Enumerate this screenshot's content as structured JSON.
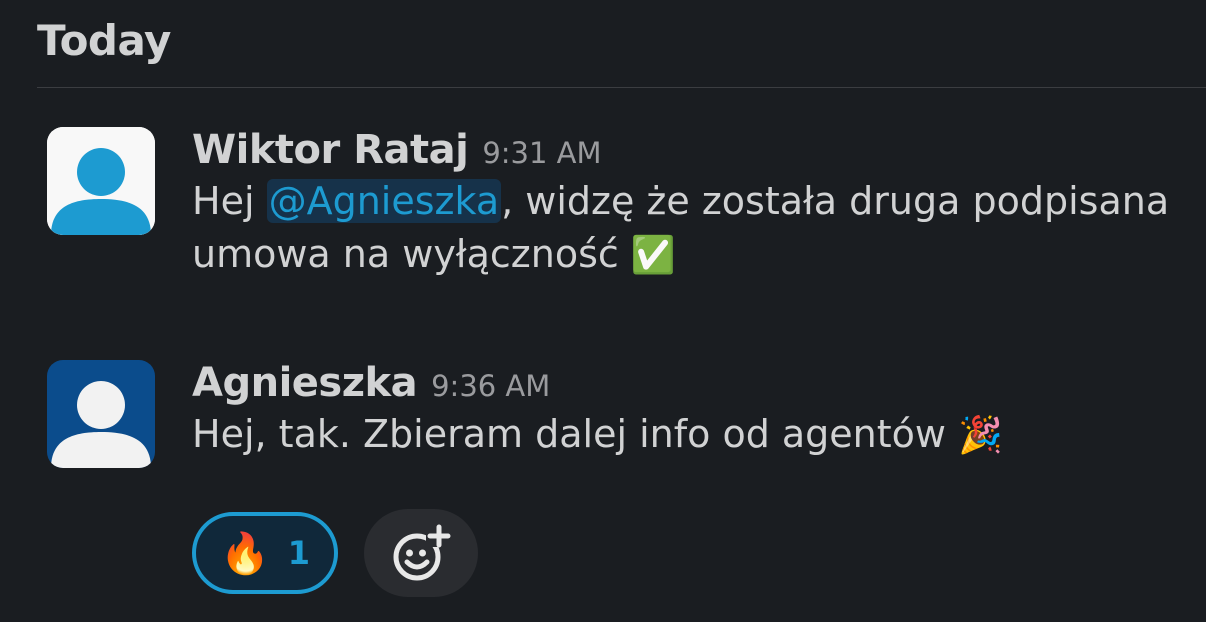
{
  "header": {
    "title": "Today"
  },
  "messages": [
    {
      "author": "Wiktor Rataj",
      "time": "9:31 AM",
      "avatar_color": "#ffffff",
      "avatar_figure_color": "#1d9bd1",
      "text_before": "Hej ",
      "mention": "@Agnieszka",
      "text_after": ", widzę że została druga podpisana umowa na wyłączność ",
      "emoji": "✅"
    },
    {
      "author": "Agnieszka",
      "time": "9:36 AM",
      "avatar_color": "#0b4c8c",
      "avatar_figure_color": "#ffffff",
      "text": "Hej, tak. Zbieram dalej info od agentów ",
      "emoji": "🎉"
    }
  ],
  "reactions": [
    {
      "emoji": "🔥",
      "count": "1",
      "active": true
    }
  ],
  "add_reaction": {
    "icon": "add-emoji-icon"
  },
  "colors": {
    "background": "#1a1d21",
    "text": "#d1d2d3",
    "muted": "#9a9b9e",
    "accent": "#1d9bd1",
    "mention_bg": "#16324a"
  }
}
